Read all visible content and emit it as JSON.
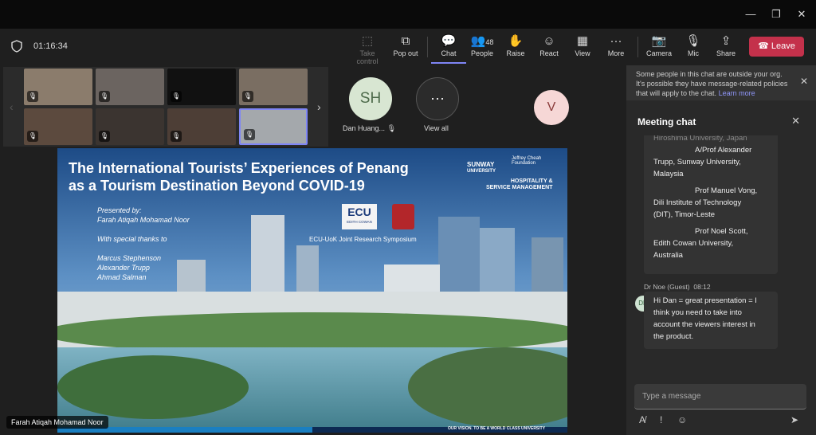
{
  "window": {
    "minimize": "—",
    "restore": "❐",
    "close": "✕"
  },
  "meeting": {
    "timer": "01:16:34"
  },
  "toolbar": {
    "take_control": "Take control",
    "pop_out": "Pop out",
    "chat": "Chat",
    "people": "People",
    "people_count": "48",
    "raise": "Raise",
    "react": "React",
    "view": "View",
    "more": "More",
    "camera": "Camera",
    "mic": "Mic",
    "share": "Share",
    "leave": "Leave"
  },
  "participants": {
    "dan_initials": "SH",
    "dan_name": "Dan Huang...",
    "view_all": "View all",
    "v_initial": "V",
    "presenter": "Farah Atiqah Mohamad Noor"
  },
  "slide": {
    "title1": "The International Tourists’ Experiences of Penang",
    "title2": "as a Tourism Destination Beyond COVID-19",
    "presented_by": "Presented by:",
    "presenter": "Farah Atiqah Mohamad Noor",
    "thanks": "With special thanks to",
    "thanks1": "Marcus Stephenson",
    "thanks2": "Alexander Trupp",
    "thanks3": "Ahmad Salman",
    "sunway": "SUNWAY",
    "university": "UNIVERSITY",
    "foundation": "Jeffrey Cheah Foundation",
    "hospitality": "HOSPITALITY &",
    "service": "SERVICE MANAGEMENT",
    "ecu": "ECU",
    "ecu_sub": "EDITH COWAN",
    "symposium": "ECU-UoK Joint Research Symposium",
    "vision": "OUR VISION. TO BE A WORLD CLASS UNIVERSITY"
  },
  "chat": {
    "notice": "Some people in this chat are outside your org. It's possible they have message-related policies that will apply to the chat.",
    "notice_link": "Learn more",
    "title": "Meeting chat",
    "cut_line": "Hiroshima University, Japan",
    "m1": "A/Prof Alexander",
    "m2": "Trupp, Sunway University,",
    "m3": "Malaysia",
    "m4": "Prof Manuel Vong,",
    "m5": "Dili Institute of Technology",
    "m6": "(DIT), Timor-Leste",
    "m7": "Prof Noel Scott,",
    "m8": "Edith Cowan University,",
    "m9": "Australia",
    "sender": "Dr Noe (Guest)",
    "time": "08:12",
    "avatar": "DN",
    "r1": "Hi Dan = great presentation = I",
    "r2": "think you need to take into",
    "r3": "account the viewers interest in",
    "r4": "the product.",
    "placeholder": "Type a message"
  }
}
